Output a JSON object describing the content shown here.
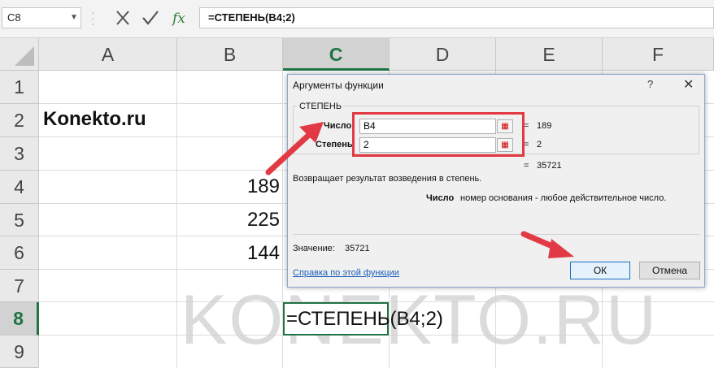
{
  "formula_bar": {
    "name_box": "C8",
    "formula": "=СТЕПЕНЬ(B4;2)"
  },
  "columns": [
    "A",
    "B",
    "C",
    "D",
    "E",
    "F"
  ],
  "rows": [
    "1",
    "2",
    "3",
    "4",
    "5",
    "6",
    "7",
    "8",
    "9"
  ],
  "cells": {
    "a2": "Konekto.ru",
    "b4": "189",
    "b5": "225",
    "b6": "144",
    "c8": "=СТЕПЕНЬ(B4;2)"
  },
  "watermark": "KONEKTO.RU",
  "dialog": {
    "title": "Аргументы функции",
    "help_glyph": "?",
    "close_glyph": "✕",
    "function_name": "СТЕПЕНЬ",
    "args": [
      {
        "label": "Число",
        "value": "B4",
        "result": "189"
      },
      {
        "label": "Степень",
        "value": "2",
        "result": "2"
      }
    ],
    "eq_sign": "=",
    "total_result": "35721",
    "description": "Возвращает результат возведения в степень.",
    "arg_help_name": "Число",
    "arg_help_text": "номер основания - любое действительное число.",
    "value_label": "Значение:",
    "value": "35721",
    "help_link": "Справка по этой функции",
    "ok_label": "ОК",
    "cancel_label": "Отмена"
  },
  "colors": {
    "accent_green": "#217346",
    "highlight_red": "#e23a44",
    "link_blue": "#1d5fb8"
  }
}
